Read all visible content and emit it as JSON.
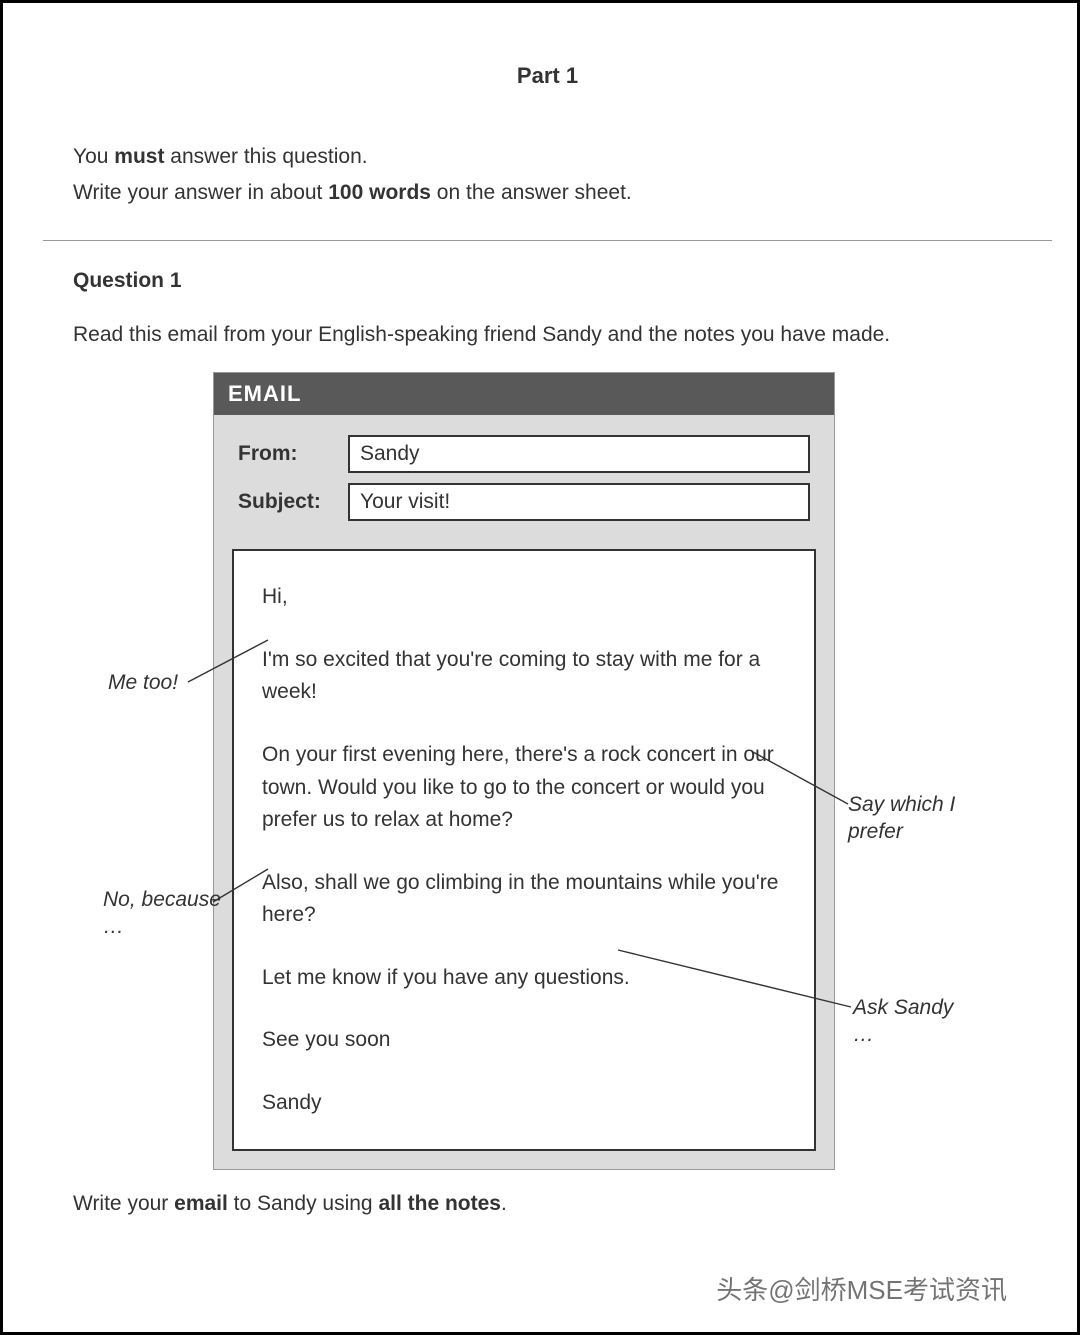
{
  "part_title": "Part 1",
  "instructions": {
    "line1_pre": "You ",
    "line1_bold": "must",
    "line1_post": " answer this question.",
    "line2_pre": "Write your answer in about ",
    "line2_bold": "100 words",
    "line2_post": " on the answer sheet."
  },
  "question_heading": "Question 1",
  "question_instruction": "Read this email from your English-speaking friend Sandy and the notes you have made.",
  "email": {
    "header": "EMAIL",
    "from_label": "From:",
    "from_value": "Sandy",
    "subject_label": "Subject:",
    "subject_value": "Your visit!",
    "body": {
      "greeting": "Hi,",
      "p1": "I'm so excited that you're coming to stay with me for a week!",
      "p2": "On your first evening here, there's a rock concert in our town. Would you like to go to the concert or would you prefer us to relax at home?",
      "p3": "Also, shall we go climbing in the mountains while you're here?",
      "p4": "Let me know if you have any questions.",
      "signoff1": "See you soon",
      "signoff2": "Sandy"
    }
  },
  "notes": {
    "n1": "Me too!",
    "n2": "Say which I prefer",
    "n3": "No, because …",
    "n4": "Ask Sandy …"
  },
  "final": {
    "pre": "Write your ",
    "b1": "email",
    "mid": " to Sandy using ",
    "b2": "all the notes",
    "post": "."
  },
  "watermark": "头条@剑桥MSE考试资讯"
}
